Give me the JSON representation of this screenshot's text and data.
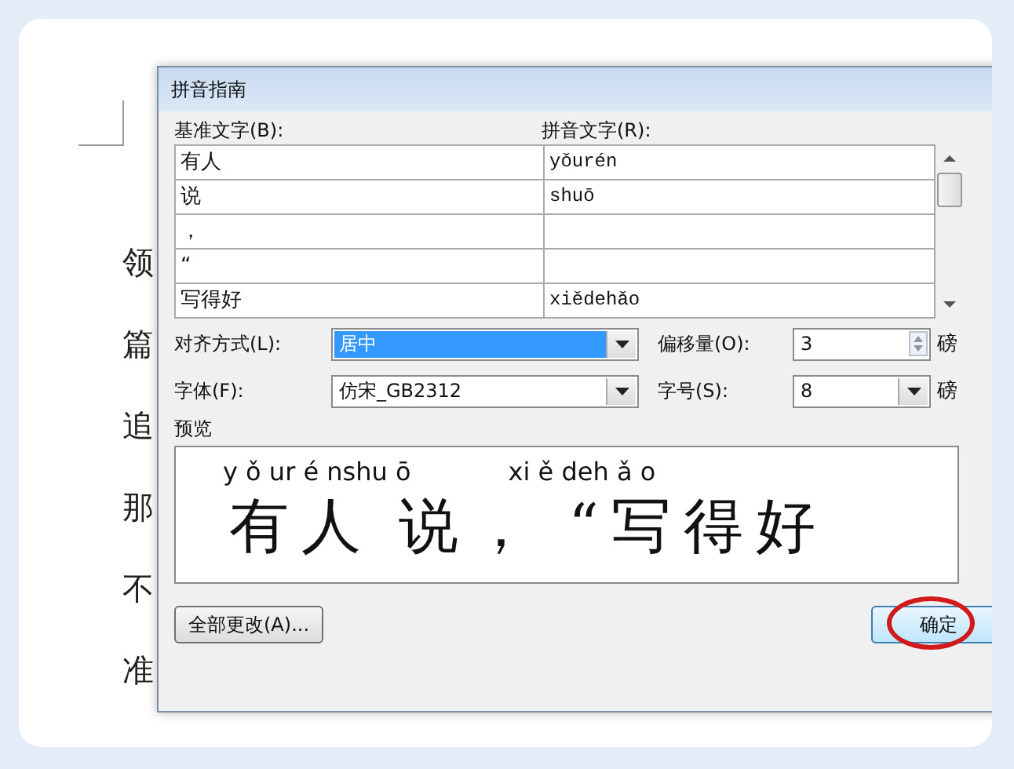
{
  "document": {
    "lines": [
      "领",
      "篇",
      "追",
      "那",
      "不",
      "准"
    ]
  },
  "dialog": {
    "title": "拼音指南",
    "columns": [
      "基准文字(B):",
      "拼音文字(R):"
    ],
    "rows": [
      {
        "base": "有人",
        "pinyin": "yǒurén"
      },
      {
        "base": "说",
        "pinyin": "shuō"
      },
      {
        "base": "，",
        "pinyin": ""
      },
      {
        "base": "“",
        "pinyin": ""
      },
      {
        "base": "写得好",
        "pinyin": "xiědehǎo"
      }
    ],
    "alignment": {
      "label": "对齐方式(L):",
      "value": "居中"
    },
    "offset": {
      "label": "偏移量(O):",
      "value": "3",
      "unit": "磅"
    },
    "font": {
      "label": "字体(F):",
      "value": "仿宋_GB2312"
    },
    "size": {
      "label": "字号(S):",
      "value": "8",
      "unit": "磅"
    },
    "preview": {
      "label": "预览",
      "pinyin": [
        "y ǒ ur é nshu ō",
        "xi ě deh ǎ o"
      ],
      "text": [
        "有人",
        "说，",
        "“写得好"
      ]
    },
    "buttons": [
      {
        "label": "全部更改(A)...",
        "highlighted": false
      },
      {
        "label": "确定",
        "highlighted": true
      }
    ]
  }
}
